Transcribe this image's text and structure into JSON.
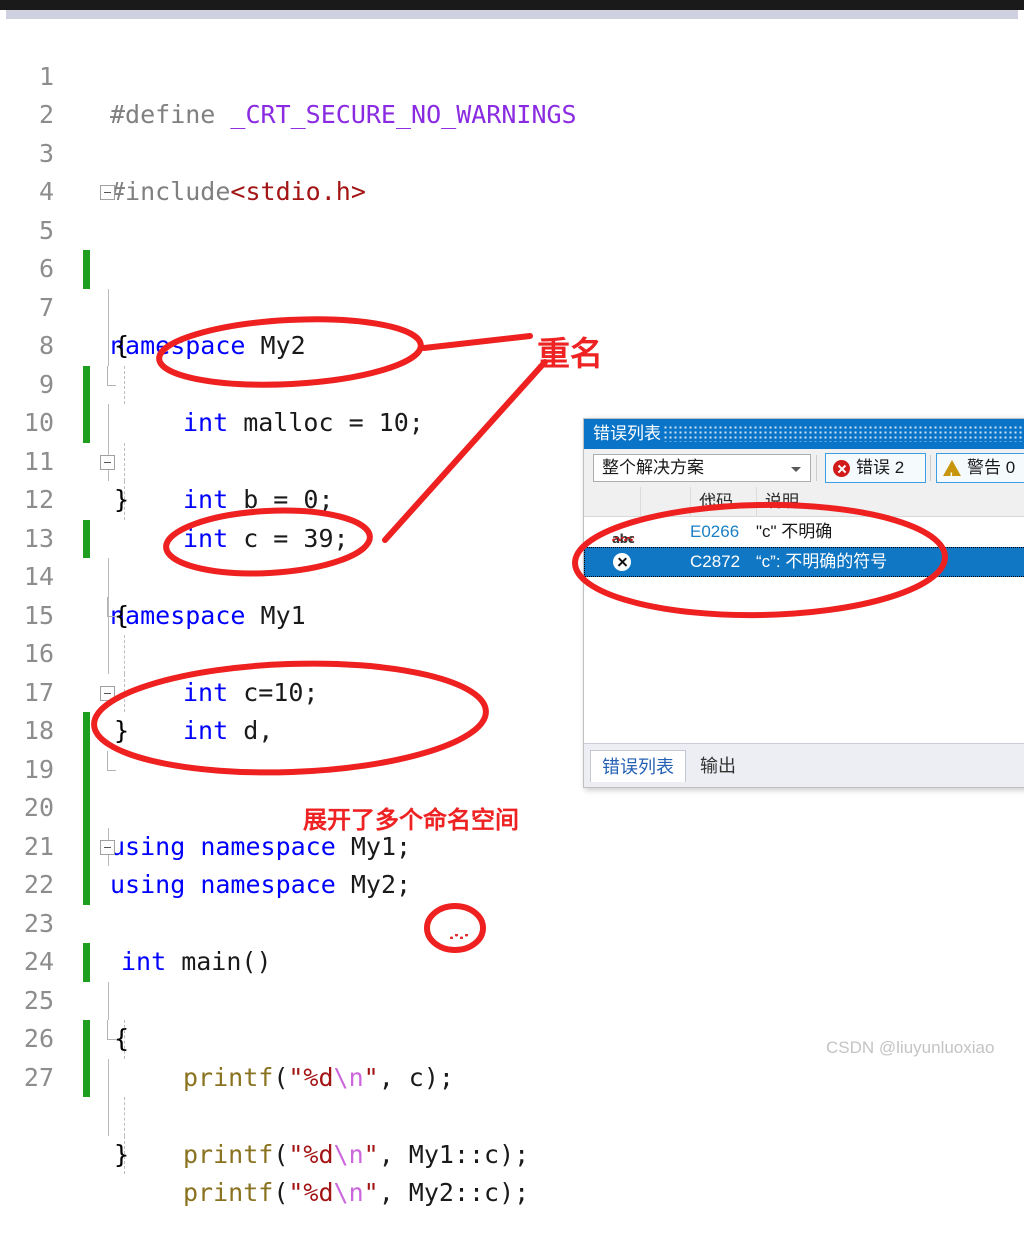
{
  "window": {
    "scrollbar_label": "horizontal-scrollbar"
  },
  "editor": {
    "language": "C++",
    "lines": [
      {
        "n": "1",
        "text": "#define _CRT_SECURE_NO_WARNINGS"
      },
      {
        "n": "2",
        "text": ""
      },
      {
        "n": "3",
        "text": "#include<stdio.h>"
      },
      {
        "n": "4",
        "text": ""
      },
      {
        "n": "5",
        "text": "namespace My2"
      },
      {
        "n": "6",
        "text": "{"
      },
      {
        "n": "7",
        "text": "    int malloc = 10;"
      },
      {
        "n": "8",
        "text": "    int b = 0;"
      },
      {
        "n": "9",
        "text": "    int c = 39;"
      },
      {
        "n": "10",
        "text": "}"
      },
      {
        "n": "11",
        "text": ""
      },
      {
        "n": "12",
        "text": "namespace My1"
      },
      {
        "n": "13",
        "text": "{"
      },
      {
        "n": "14",
        "text": "    int c=10;"
      },
      {
        "n": "15",
        "text": "    int d,"
      },
      {
        "n": "16",
        "text": "}"
      },
      {
        "n": "17",
        "text": ""
      },
      {
        "n": "18",
        "text": "using namespace My1;"
      },
      {
        "n": "19",
        "text": "using namespace My2;"
      },
      {
        "n": "20",
        "text": ""
      },
      {
        "n": "21",
        "text": ""
      },
      {
        "n": "22",
        "text": "int main()"
      },
      {
        "n": "23",
        "text": "{"
      },
      {
        "n": "24",
        "text": "    printf(\"%d\\n\", c);"
      },
      {
        "n": "25",
        "text": "    printf(\"%d\\n\", My1::c);"
      },
      {
        "n": "26",
        "text": "    printf(\"%d\\n\", My2::c);"
      },
      {
        "n": "27",
        "text": "}"
      }
    ],
    "tokens": {
      "define": "#define",
      "macro_name": "_CRT_SECURE_NO_WARNINGS",
      "include": "#include",
      "include_target": "<stdio.h>",
      "kw_namespace": "namespace",
      "kw_using": "using",
      "kw_int": "int",
      "ns_my1": "My1",
      "ns_my2": "My2",
      "fn_printf": "printf",
      "fmt_open": "\"%d",
      "fmt_esc": "\\n",
      "fmt_close": "\"",
      "stmt_malloc": " malloc = 10;",
      "stmt_b": " b = 0;",
      "stmt_c39": " c = 39;",
      "stmt_c10": " c=10;",
      "stmt_d": " d,",
      "brace_open": "{",
      "brace_close": "}",
      "main_sig": " main()",
      "arg_c": ", c);",
      "arg_my1c": ", My1::c);",
      "arg_my2c": ", My2::c);",
      "printf_open": "(",
      "indent4": "    "
    },
    "colors": {
      "preprocessor": "#808080",
      "macro": "#8a2be2",
      "include_path": "#a31515",
      "keyword": "#0000ff",
      "plain": "#1a1a1a",
      "function": "#8a7320",
      "string": "#a31515",
      "escape": "#cc66dd",
      "line_number": "#8d8d8d",
      "change_marker": "#1e9e1e"
    }
  },
  "error_panel": {
    "title": "错误列表",
    "scope_value": "整个解决方案",
    "error_button": "错误 2",
    "warning_button": "警告 0",
    "columns": [
      "",
      "",
      "代码",
      "说明"
    ],
    "col_code": "代码",
    "col_desc": "说明",
    "rows": [
      {
        "icon": "abc-squiggle-icon",
        "code": "E0266",
        "description": "\"c\" 不明确",
        "selected": false
      },
      {
        "icon": "error-x-icon",
        "code": "C2872",
        "description": "“c”: 不明确的符号",
        "selected": true
      }
    ],
    "tabs": [
      {
        "label": "错误列表",
        "active": true
      },
      {
        "label": "输出",
        "active": false
      }
    ],
    "colors": {
      "titlebar": "#0a74c8",
      "selection": "#1077c4",
      "error_red": "#d21b1b",
      "warning_gold": "#c8960c",
      "code_link": "#1b7fc4"
    }
  },
  "annotations": {
    "rename_label": "重名",
    "expand_label": "展开了多个命名空间",
    "color": "#ee2222",
    "shapes": [
      {
        "name": "ellipse-int-c-39",
        "kind": "ellipse"
      },
      {
        "name": "ellipse-int-c-10",
        "kind": "ellipse"
      },
      {
        "name": "ellipse-using-block",
        "kind": "ellipse"
      },
      {
        "name": "ellipse-error-rows",
        "kind": "ellipse"
      },
      {
        "name": "ellipse-arg-c",
        "kind": "ellipse"
      },
      {
        "name": "leader-line-to-rename-1",
        "kind": "line"
      },
      {
        "name": "leader-line-to-rename-2",
        "kind": "line"
      }
    ]
  },
  "watermark": {
    "text": "CSDN @liuyunluoxiao"
  }
}
